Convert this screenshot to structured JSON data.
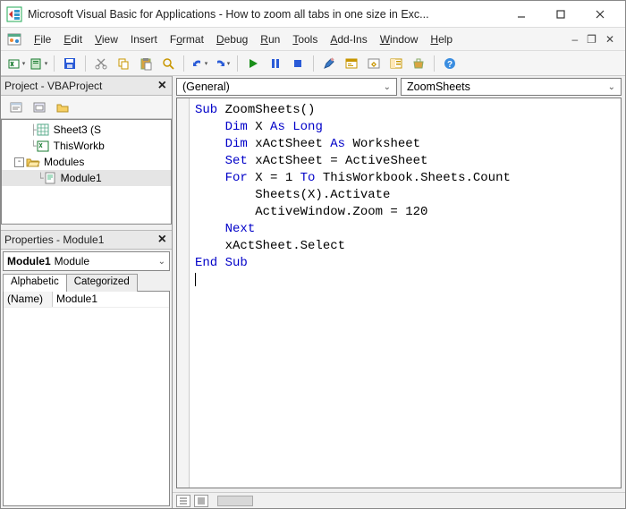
{
  "window": {
    "title": "Microsoft Visual Basic for Applications - How to zoom all tabs in one size in Exc..."
  },
  "menu": {
    "file": "File",
    "edit": "Edit",
    "view": "View",
    "insert": "Insert",
    "format": "Format",
    "debug": "Debug",
    "run": "Run",
    "tools": "Tools",
    "addins": "Add-Ins",
    "window": "Window",
    "help": "Help"
  },
  "project_panel": {
    "title": "Project - VBAProject",
    "tree": {
      "sheet3": "Sheet3 (S",
      "thiswb": "ThisWorkb",
      "modules_folder": "Modules",
      "module1": "Module1"
    }
  },
  "properties_panel": {
    "title": "Properties - Module1",
    "combo_bold": "Module1",
    "combo_rest": "Module",
    "tab_alpha": "Alphabetic",
    "tab_cat": "Categorized",
    "row_name_k": "(Name)",
    "row_name_v": "Module1"
  },
  "code_dropdowns": {
    "left": "(General)",
    "right": "ZoomSheets"
  },
  "code": {
    "l1a": "Sub",
    "l1b": " ZoomSheets()",
    "l2a": "    ",
    "l2b": "Dim",
    "l2c": " X ",
    "l2d": "As Long",
    "l3a": "    ",
    "l3b": "Dim",
    "l3c": " xActSheet ",
    "l3d": "As",
    "l3e": " Worksheet",
    "l4a": "    ",
    "l4b": "Set",
    "l4c": " xActSheet = ActiveSheet",
    "l5a": "    ",
    "l5b": "For",
    "l5c": " X = 1 ",
    "l5d": "To",
    "l5e": " ThisWorkbook.Sheets.Count",
    "l6": "        Sheets(X).Activate",
    "l7": "        ActiveWindow.Zoom = 120",
    "l8a": "    ",
    "l8b": "Next",
    "l9": "    xActSheet.Select",
    "l10": "End Sub"
  }
}
